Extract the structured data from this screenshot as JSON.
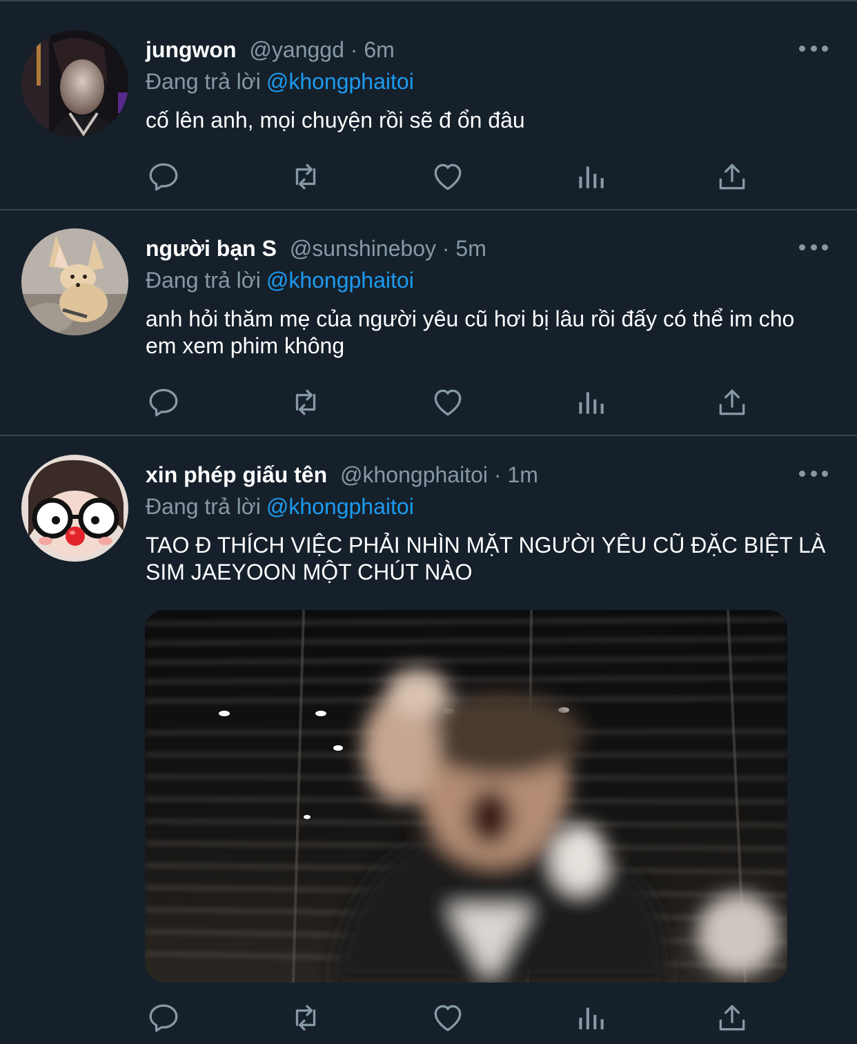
{
  "tweets": [
    {
      "name": "jungwon",
      "handle": "@yanggd",
      "time": "· 6m",
      "reply_prefix": "Đang trả lời",
      "reply_to": "@khongphaitoi",
      "text": "cố lên anh, mọi chuyện rồi sẽ đ ổn đâu",
      "avatar_icon": "portrait-photo"
    },
    {
      "name": "người bạn S",
      "handle": "@sunshineboy",
      "time": "· 5m",
      "reply_prefix": "Đang trả lời",
      "reply_to": "@khongphaitoi",
      "text": "anh hỏi thăm mẹ của người yêu cũ hơi bị lâu rồi đấy có thể im cho em xem phim không",
      "avatar_icon": "fennec-fox-photo"
    },
    {
      "name": "xin phép giấu tên",
      "handle": "@khongphaitoi",
      "time": "· 1m",
      "reply_prefix": "Đang trả lời",
      "reply_to": "@khongphaitoi",
      "text": "TAO Đ THÍCH VIỆC PHẢI NHÌN MẶT NGƯỜI YÊU CŨ ĐẶC BIỆT LÀ SIM JAEYOON MỘT CHÚT NÀO",
      "avatar_icon": "glasses-clown-photo",
      "media": "blurred-screaming-person-gif"
    }
  ],
  "icons": {
    "more": "more-dots-icon",
    "reply": "reply-icon",
    "retweet": "retweet-icon",
    "like": "like-heart-icon",
    "stats": "analytics-icon",
    "share": "share-icon"
  },
  "colors": {
    "background": "#15202b",
    "divider": "#38444d",
    "secondary_text": "#8899a6",
    "link": "#1d9bf0"
  }
}
